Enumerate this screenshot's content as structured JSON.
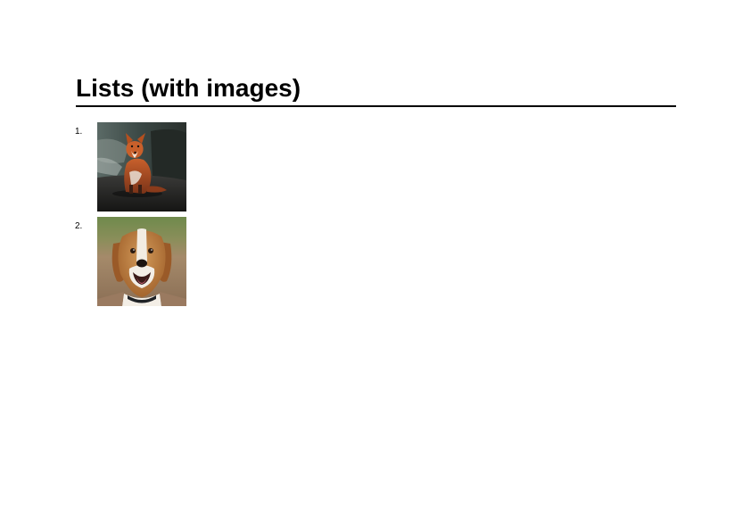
{
  "document": {
    "title": "Lists (with images)"
  },
  "list": {
    "items": [
      {
        "number": "1.",
        "image": "fox-photo",
        "alt": "fox"
      },
      {
        "number": "2.",
        "image": "beagle-photo",
        "alt": "beagle dog"
      }
    ]
  }
}
